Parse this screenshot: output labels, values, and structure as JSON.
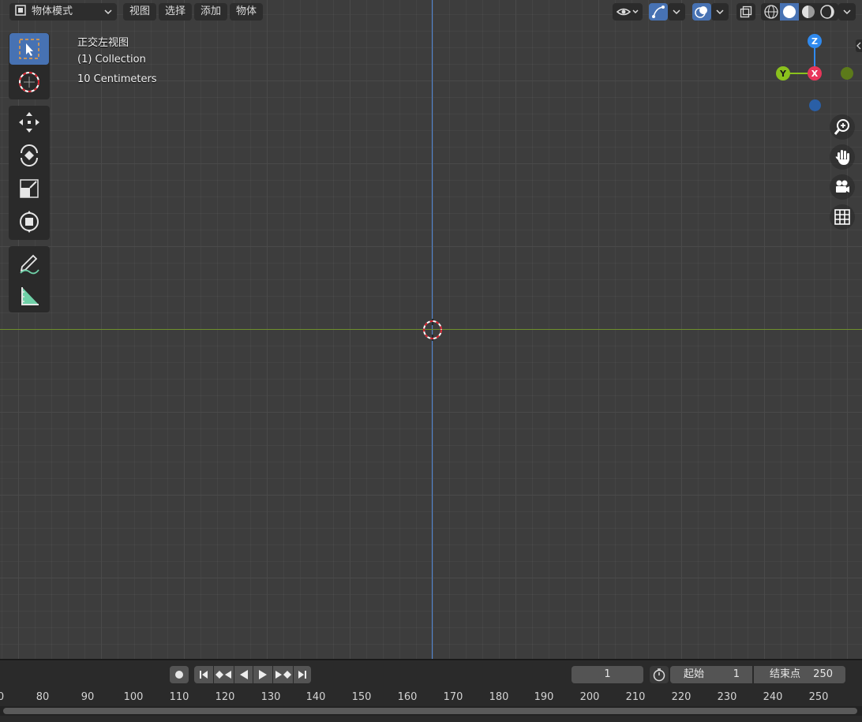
{
  "header": {
    "mode_label": "物体模式",
    "menus": [
      "视图",
      "选择",
      "添加",
      "物体"
    ]
  },
  "overlay": {
    "view_name": "正交左视图",
    "collection": "(1) Collection",
    "scale": "10 Centimeters"
  },
  "gizmo": {
    "z": "Z",
    "y": "Y",
    "x": "X"
  },
  "timeline": {
    "current_frame": "1",
    "start_label": "起始",
    "start_value": "1",
    "end_label": "结束点",
    "end_value": "250",
    "ruler": [
      "0",
      "80",
      "90",
      "100",
      "110",
      "120",
      "130",
      "140",
      "150",
      "160",
      "170",
      "180",
      "190",
      "200",
      "210",
      "220",
      "230",
      "240",
      "250"
    ]
  },
  "colors": {
    "accent": "#4772b3",
    "axis_z": "#4f86d6",
    "axis_y": "#6f8f2d",
    "gizmo_x": "#e8365a",
    "gizmo_y": "#8ac11d",
    "gizmo_z": "#2f8aef"
  }
}
